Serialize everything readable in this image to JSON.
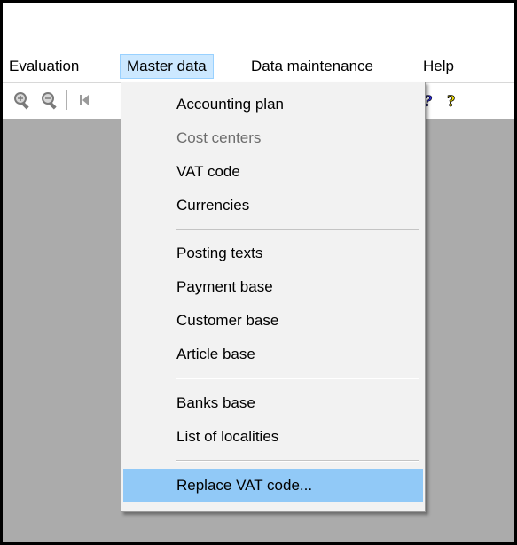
{
  "menubar": {
    "items": [
      {
        "label": "Evaluation"
      },
      {
        "label": "Master data"
      },
      {
        "label": "Data maintenance"
      },
      {
        "label": "Help"
      }
    ]
  },
  "toolbar": {
    "icons": [
      "zoom-in-icon",
      "zoom-out-icon",
      "first-record-icon",
      "whats-this-help-icon",
      "help-icon"
    ],
    "colors": {
      "help_yellow": "#f5e000",
      "help_blue": "#2b2bd6"
    }
  },
  "dropdown": {
    "items": [
      {
        "label": "Accounting plan",
        "enabled": true
      },
      {
        "label": "Cost centers",
        "enabled": false
      },
      {
        "label": "VAT code",
        "enabled": true
      },
      {
        "label": "Currencies",
        "enabled": true
      },
      {
        "label": "Posting texts",
        "enabled": true
      },
      {
        "label": "Payment base",
        "enabled": true
      },
      {
        "label": "Customer base",
        "enabled": true
      },
      {
        "label": "Article base",
        "enabled": true
      },
      {
        "label": "Banks base",
        "enabled": true
      },
      {
        "label": "List of localities",
        "enabled": true
      },
      {
        "label": "Replace VAT code...",
        "enabled": true,
        "highlighted": true
      }
    ],
    "highlight_color": "#91c9f7"
  }
}
